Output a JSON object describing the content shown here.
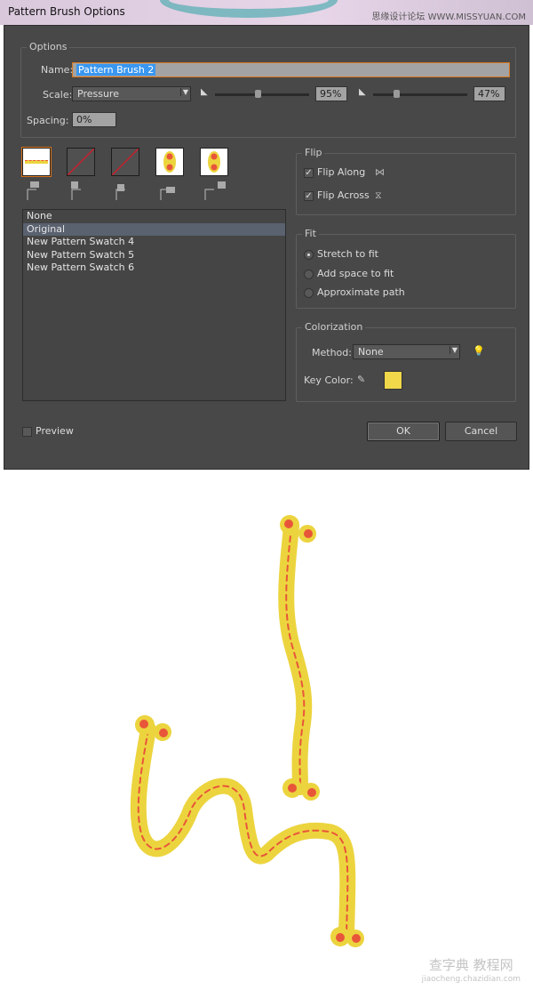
{
  "window": {
    "title": "Pattern Brush Options",
    "watermark_top": "思缘设计论坛  WWW.MISSYUAN.COM"
  },
  "options": {
    "legend": "Options",
    "name_label": "Name:",
    "name_value": "Pattern Brush 2",
    "scale_label": "Scale:",
    "scale_value": "Pressure",
    "scale_min": "95%",
    "scale_max": "47%",
    "scale_min_pct": 95,
    "scale_max_pct": 47,
    "spacing_label": "Spacing:",
    "spacing_value": "0%"
  },
  "tiles": [
    {
      "name": "side-tile",
      "selected": true
    },
    {
      "name": "outer-corner-tile"
    },
    {
      "name": "inner-corner-tile"
    },
    {
      "name": "start-tile"
    },
    {
      "name": "end-tile"
    }
  ],
  "swatches": [
    "None",
    "Original",
    "New Pattern Swatch 4",
    "New Pattern Swatch 5",
    "New Pattern Swatch 6"
  ],
  "selected_swatch": "Original",
  "flip": {
    "legend": "Flip",
    "along": "Flip Along",
    "across": "Flip Across",
    "along_checked": true,
    "across_checked": true
  },
  "fit": {
    "legend": "Fit",
    "options": [
      "Stretch to fit",
      "Add space to fit",
      "Approximate path"
    ],
    "selected": "Stretch to fit"
  },
  "colorization": {
    "legend": "Colorization",
    "method_label": "Method:",
    "method_value": "None",
    "key_color_label": "Key Color:",
    "key_color": "#f0d84a"
  },
  "preview": {
    "label": "Preview",
    "checked": false
  },
  "buttons": {
    "ok": "OK",
    "cancel": "Cancel"
  },
  "colors": {
    "brush_yellow": "#ecd43e",
    "brush_red": "#e8563a",
    "dialog_bg": "#484848"
  },
  "watermark_bottom": {
    "main": "查字典 教程网",
    "url": "jiaocheng.chazidian.com"
  }
}
